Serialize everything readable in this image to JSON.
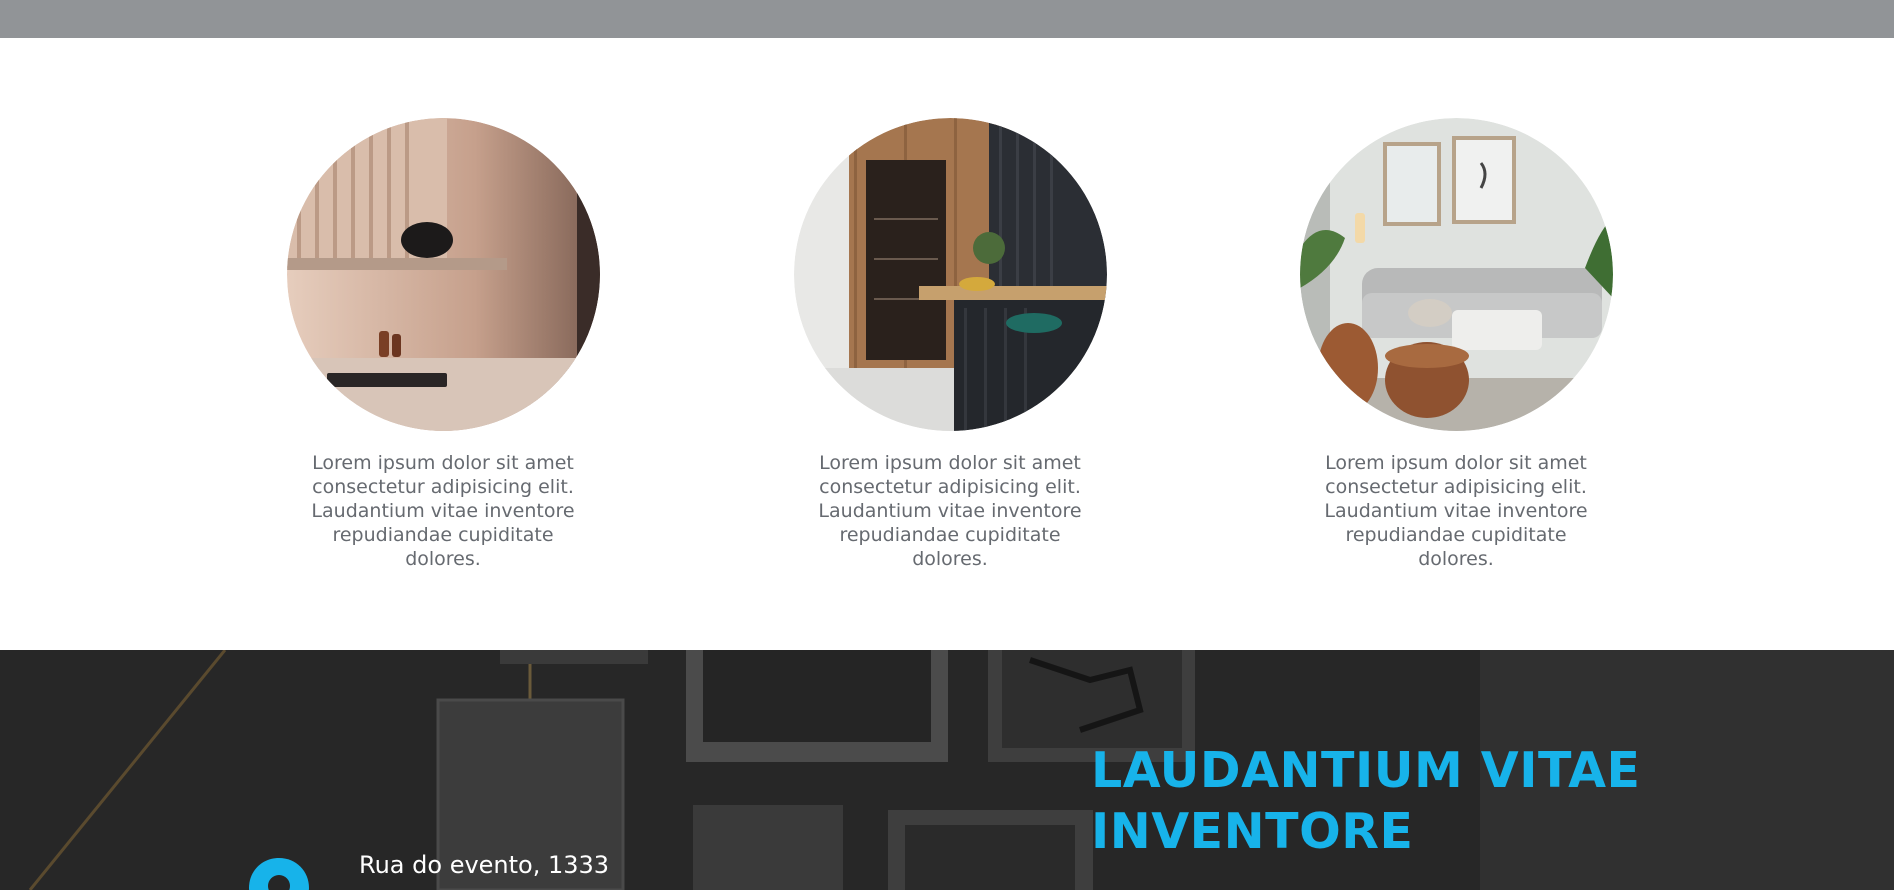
{
  "features": [
    {
      "image": "kitchen-shelf-lamp-photo",
      "text": "Lorem ipsum dolor sit amet consectetur adipisicing elit. Laudantium vitae inventore repudiandae cupiditate dolores."
    },
    {
      "image": "kitchen-island-photo",
      "text": "Lorem ipsum dolor sit amet consectetur adipisicing elit. Laudantium vitae inventore repudiandae cupiditate dolores."
    },
    {
      "image": "living-room-sofa-photo",
      "text": "Lorem ipsum dolor sit amet consectetur adipisicing elit. Laudantium vitae inventore repudiandae cupiditate dolores."
    }
  ],
  "contact": {
    "title": "LAUDANTIUM VITAE INVENTORE",
    "address": "Rua do evento, 1333",
    "pin_icon": "location-pin-icon"
  },
  "colors": {
    "accent": "#17b3ea",
    "top_bar": "#919497",
    "dark_section": "#262626",
    "body_text": "#666a70"
  }
}
